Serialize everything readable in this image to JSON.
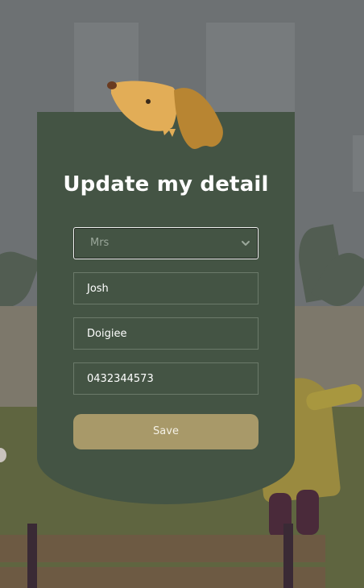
{
  "form": {
    "title": "Update my detail",
    "salutation": {
      "value": "Mrs",
      "options": [
        "Mrs"
      ]
    },
    "first_name": "Josh",
    "last_name": "Doigiee",
    "phone": "0432344573",
    "save_label": "Save"
  },
  "colors": {
    "card": "#445444",
    "button": "#a89969",
    "dog": "#e2ad57",
    "dog_ear": "#b88532"
  }
}
